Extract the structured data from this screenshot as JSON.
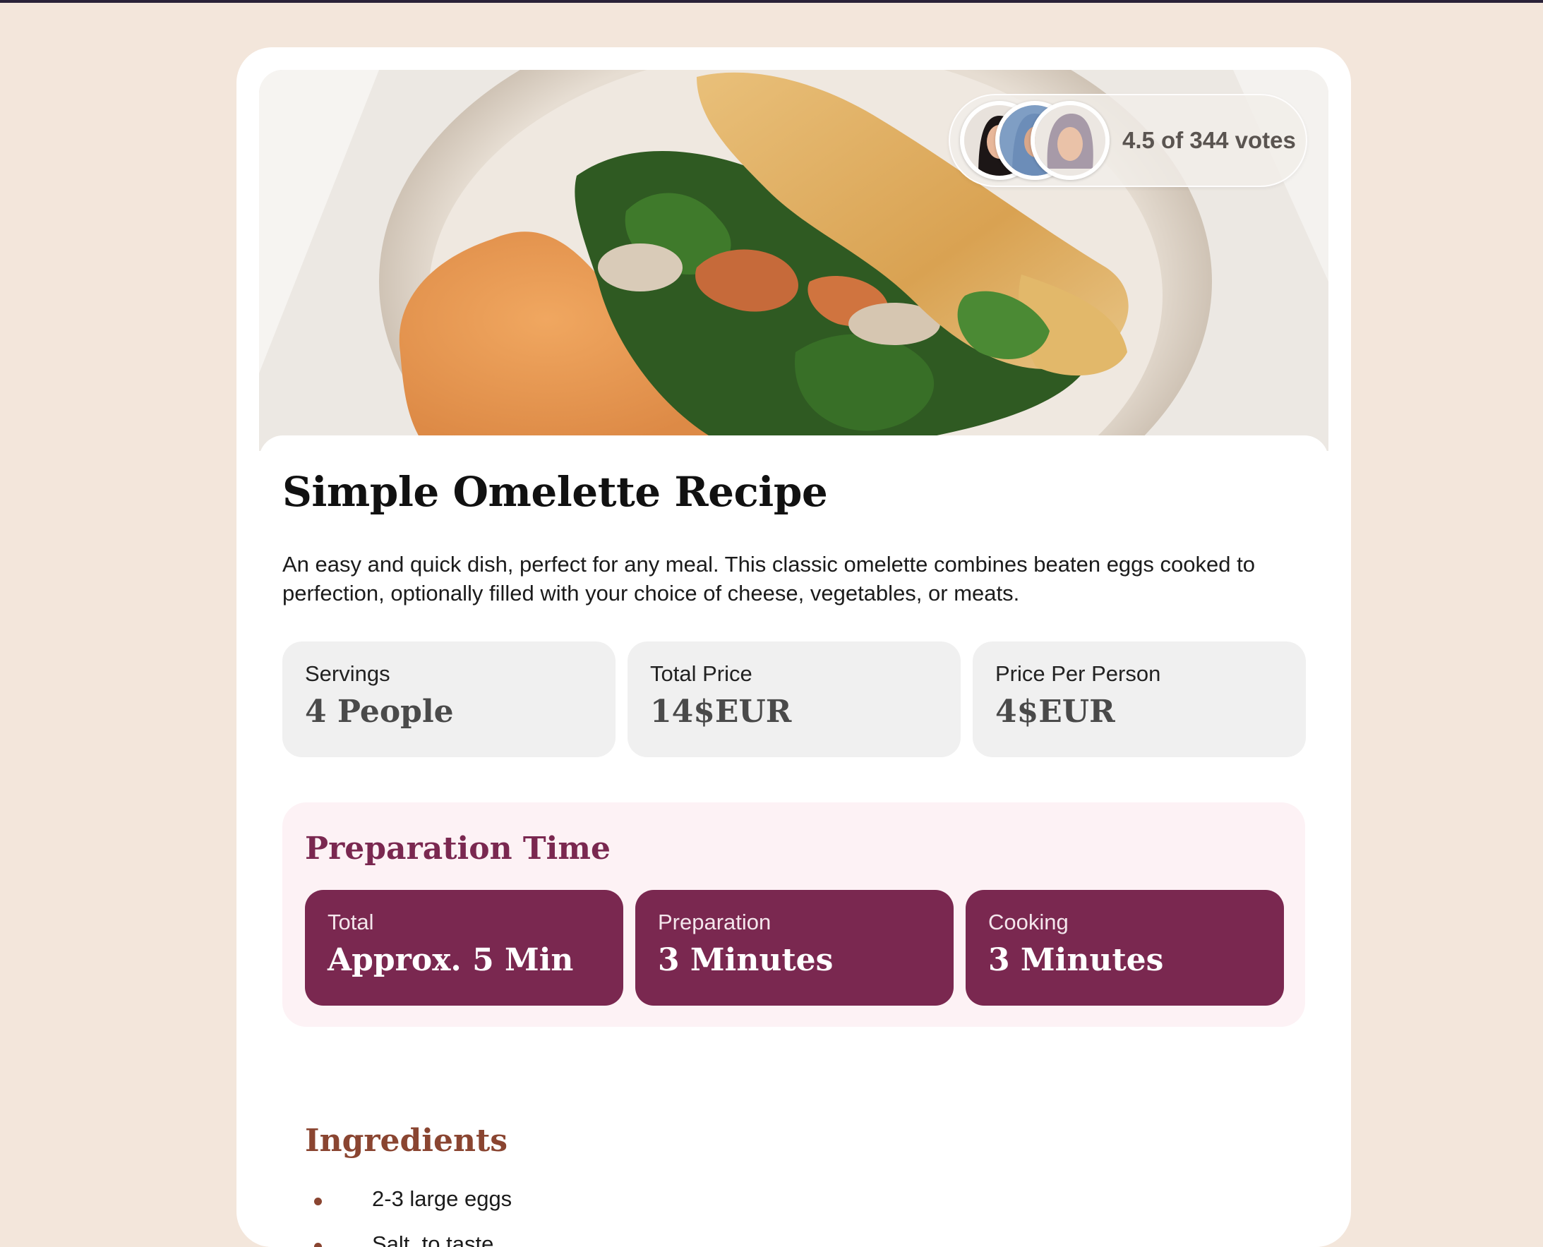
{
  "recipe": {
    "title": "Simple Omelette Recipe",
    "description": "An easy and quick dish, perfect for any meal. This classic omelette combines beaten eggs cooked to perfection, optionally filled with your choice of cheese, vegetables, or meats.",
    "rating_text": "4.5 of 344 votes"
  },
  "stats": [
    {
      "label": "Servings",
      "value": "4 People"
    },
    {
      "label": "Total Price",
      "value": "14$EUR"
    },
    {
      "label": "Price Per Person",
      "value": "4$EUR"
    }
  ],
  "preparation": {
    "title": "Preparation Time",
    "items": [
      {
        "label": "Total",
        "value": "Approx. 5 Min"
      },
      {
        "label": "Preparation",
        "value": "3 Minutes"
      },
      {
        "label": "Cooking",
        "value": "3 Minutes"
      }
    ]
  },
  "ingredients": {
    "title": "Ingredients",
    "items": [
      "2-3 large eggs",
      "Salt, to taste"
    ]
  },
  "colors": {
    "page_bg": "#f3e6db",
    "accent_plum": "#7a2850",
    "prep_bg": "#fdf2f5",
    "ingredients_brown": "#8a4531"
  }
}
